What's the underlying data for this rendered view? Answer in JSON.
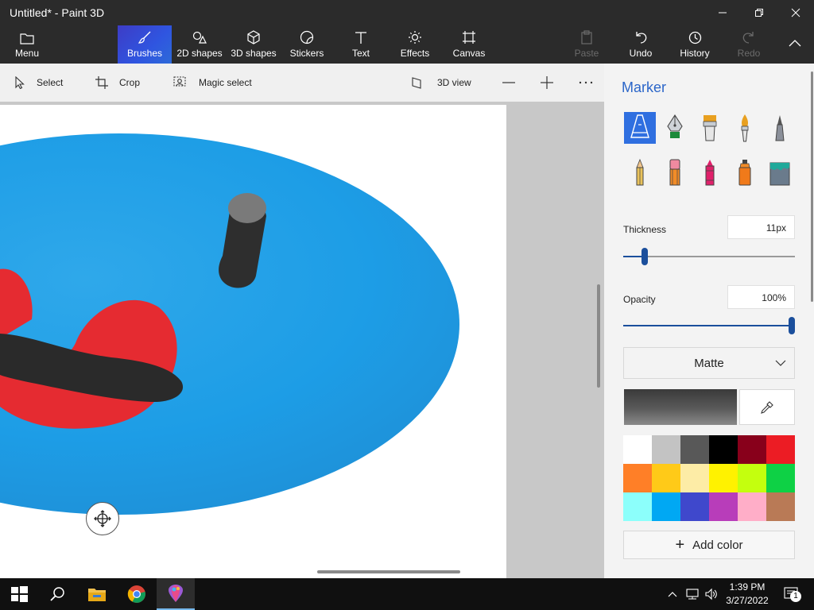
{
  "window": {
    "title": "Untitled* - Paint 3D"
  },
  "ribbon": {
    "menu_label": "Menu",
    "tabs": [
      {
        "label": "Brushes",
        "icon": "brush-icon",
        "active": true
      },
      {
        "label": "2D shapes",
        "icon": "2d-shapes-icon"
      },
      {
        "label": "3D shapes",
        "icon": "cube-icon"
      },
      {
        "label": "Stickers",
        "icon": "sticker-icon"
      },
      {
        "label": "Text",
        "icon": "text-icon"
      },
      {
        "label": "Effects",
        "icon": "sun-icon"
      },
      {
        "label": "Canvas",
        "icon": "canvas-icon"
      }
    ],
    "actions": [
      {
        "label": "Paste",
        "icon": "paste-icon",
        "enabled": false
      },
      {
        "label": "Undo",
        "icon": "undo-icon",
        "enabled": true
      },
      {
        "label": "History",
        "icon": "history-icon",
        "enabled": true
      },
      {
        "label": "Redo",
        "icon": "redo-icon",
        "enabled": false
      }
    ]
  },
  "toolbar": {
    "select_label": "Select",
    "crop_label": "Crop",
    "magic_select_label": "Magic select",
    "view3d_label": "3D view"
  },
  "panel": {
    "title": "Marker",
    "brushes": [
      {
        "name": "marker",
        "selected": true
      },
      {
        "name": "calligraphy-pen"
      },
      {
        "name": "oil-brush"
      },
      {
        "name": "watercolor"
      },
      {
        "name": "pixel-pen"
      },
      {
        "name": "pencil"
      },
      {
        "name": "eraser"
      },
      {
        "name": "crayon"
      },
      {
        "name": "spray-can"
      },
      {
        "name": "fill"
      }
    ],
    "thickness_label": "Thickness",
    "thickness_value": "11px",
    "thickness_level": 0.11,
    "opacity_label": "Opacity",
    "opacity_value": "100%",
    "opacity_level": 1.0,
    "finish_label": "Matte",
    "current_color": "#4a4a4a",
    "palette": [
      "#ffffff",
      "#c3c3c3",
      "#585858",
      "#000000",
      "#88001b",
      "#ec1c24",
      "#ff7f27",
      "#ffca18",
      "#fdeca6",
      "#fff200",
      "#c4ff0e",
      "#0ed145",
      "#8cfffb",
      "#00a8f3",
      "#3f48cc",
      "#b83dba",
      "#ffaec8",
      "#b97a56"
    ],
    "add_color_label": "Add color"
  },
  "taskbar": {
    "time": "1:39 PM",
    "date": "3/27/2022",
    "notification_count": "1"
  }
}
